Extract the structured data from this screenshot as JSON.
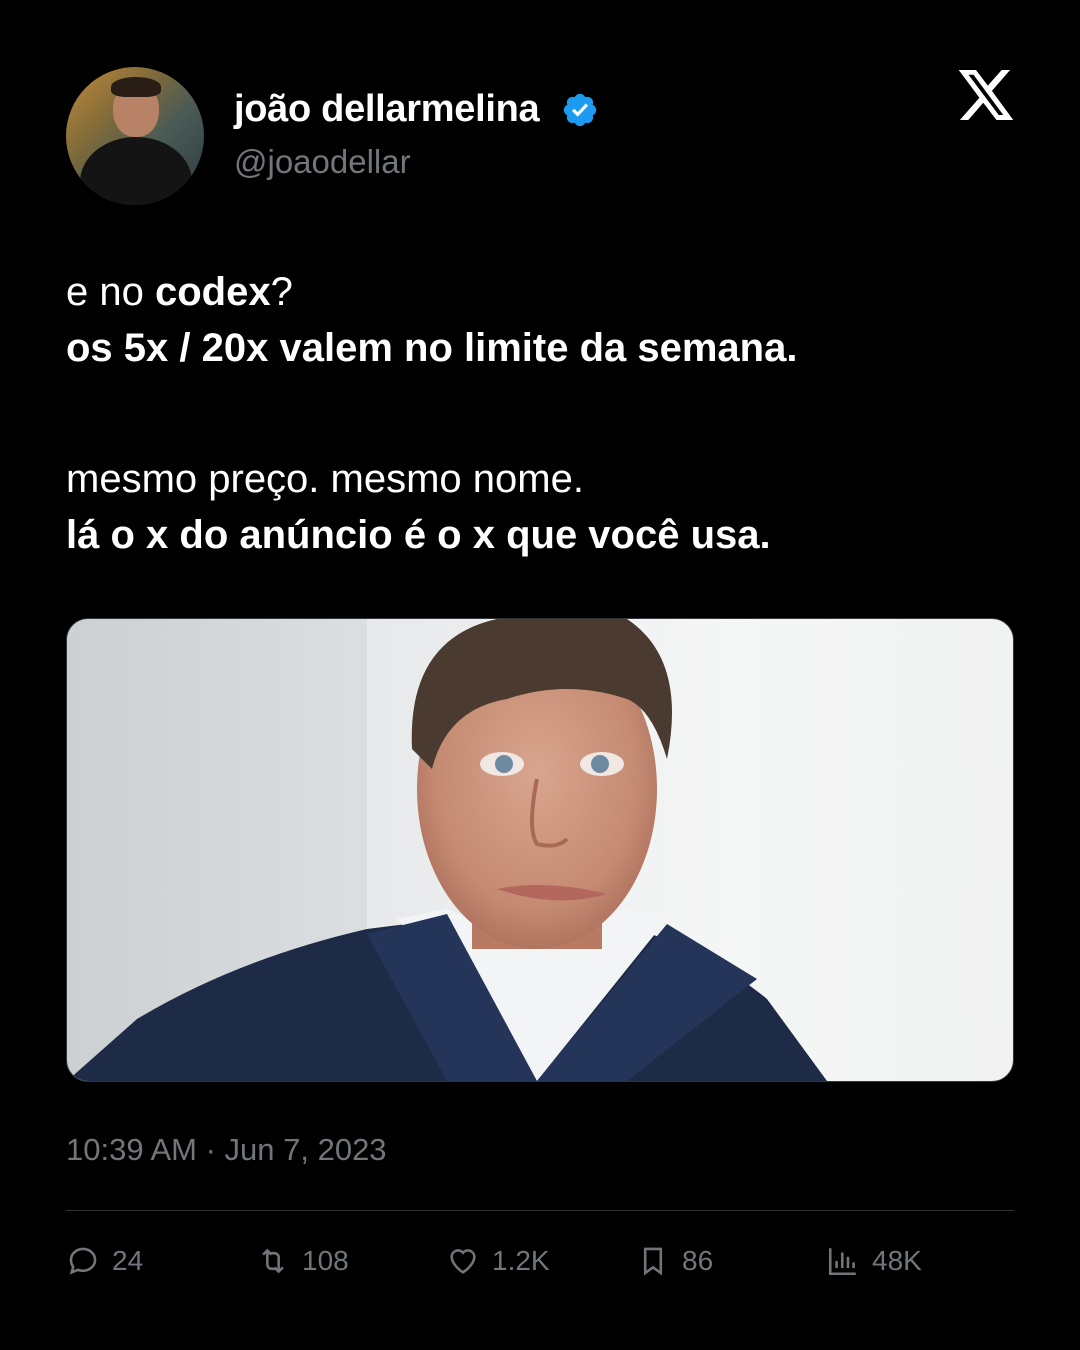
{
  "author": {
    "name": "joão dellarmelina",
    "handle": "@joaodellar"
  },
  "tweet": {
    "lines": [
      {
        "parts": [
          {
            "text": "e no ",
            "bold": false
          },
          {
            "text": "codex",
            "bold": true
          },
          {
            "text": "?",
            "bold": false
          }
        ]
      },
      {
        "parts": [
          {
            "text": "os 5x / 20x valem no limite da semana.",
            "bold": true
          }
        ]
      },
      {
        "gap": true
      },
      {
        "parts": [
          {
            "text": "mesmo preço. mesmo nome.",
            "bold": false
          }
        ]
      },
      {
        "parts": [
          {
            "text": "lá o x do anúncio é o x que você usa.",
            "bold": true
          }
        ]
      }
    ],
    "timestamp": "10:39 AM · Jun 7, 2023"
  },
  "stats": {
    "replies": "24",
    "reposts": "108",
    "likes": "1.2K",
    "bookmarks": "86",
    "views": "48K"
  },
  "icons": {
    "platform_logo": "x-logo-icon",
    "verified": "verified-badge-icon",
    "reply": "reply-icon",
    "repost": "repost-icon",
    "like": "heart-icon",
    "bookmark": "bookmark-icon",
    "views": "views-chart-icon"
  },
  "colors": {
    "background": "#000000",
    "text": "#ffffff",
    "muted": "#71767b",
    "verified": "#1d9bf0"
  }
}
